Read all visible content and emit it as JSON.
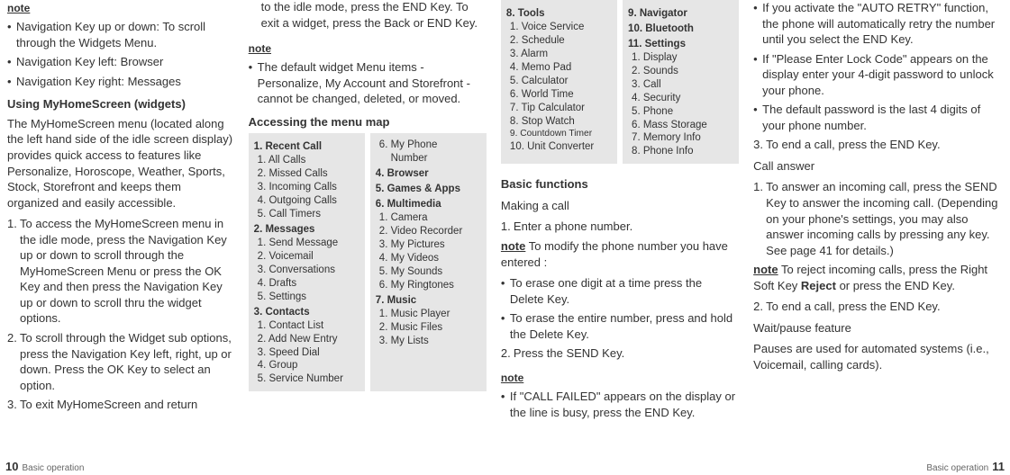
{
  "c1": {
    "noteLabel": "note",
    "b1": "Navigation Key up or down: To scroll through the Widgets Menu.",
    "b2": "Navigation Key left: Browser",
    "b3": "Navigation Key right: Messages",
    "h1": "Using MyHomeScreen (widgets)",
    "p1": "The MyHomeScreen menu (located along the left hand side of the idle screen display) provides quick access to features like Personalize, Horoscope, Weather, Sports, Stock, Storefront and keeps them organized and easily accessible.",
    "n1": "To access the MyHomeScreen menu in the idle mode, press the Navigation Key up or down to scroll through the MyHomeScreen Menu or press the OK Key and then press the Navigation Key up or down to scroll thru the widget options.",
    "n2": "To scroll through the Widget sub options, press the Navigation Key left, right, up or down. Press the OK Key to select an option.",
    "n3": "To exit MyHomeScreen and return",
    "footer": "Basic operation",
    "page": "10"
  },
  "c2": {
    "p0": "to the idle mode, press the END Key. To exit a widget, press the Back or END Key.",
    "noteLabel": "note",
    "b1": "The default widget Menu items - Personalize, My Account and Storefront - cannot be changed, deleted, or moved.",
    "h1": "Accessing the menu map"
  },
  "menuA": {
    "s1t": "1. Recent Call",
    "s1": [
      "1.  All Calls",
      "2. Missed Calls",
      "3. Incoming Calls",
      "4. Outgoing Calls",
      "5. Call Timers"
    ],
    "s2t": "2. Messages",
    "s2": [
      "1.  Send Message",
      "2. Voicemail",
      "3. Conversations",
      "4. Drafts",
      "5. Settings"
    ],
    "s3t": "3. Contacts",
    "s3": [
      "1.  Contact List",
      "2. Add New Entry",
      "3. Speed Dial",
      "4. Group",
      "5. Service Number"
    ]
  },
  "menuB": {
    "i1": "6. My Phone",
    "i1b": "    Number",
    "s4t": "4. Browser",
    "s5t": "5. Games & Apps",
    "s6t": "6. Multimedia",
    "s6": [
      "1.  Camera",
      "2. Video Recorder",
      "3. My Pictures",
      "4. My Videos",
      "5. My Sounds",
      "6. My Ringtones"
    ],
    "s7t": "7. Music",
    "s7": [
      "1.  Music Player",
      "2. Music Files",
      "3. My Lists"
    ]
  },
  "menuC": {
    "s8t": "8. Tools",
    "s8": [
      "1.  Voice Service",
      "2. Schedule",
      "3. Alarm",
      "4. Memo Pad",
      "5. Calculator",
      "6. World Time",
      "7.  Tip Calculator",
      "8. Stop Watch",
      "9. Countdown Timer",
      "10. Unit Converter"
    ]
  },
  "menuD": {
    "s9t": "9. Navigator",
    "s10t": "10. Bluetooth",
    "s11t": "11. Settings",
    "s11": [
      "1.  Display",
      "2. Sounds",
      "3. Call",
      "4. Security",
      "5. Phone",
      "6. Mass Storage",
      "7.  Memory Info",
      "8. Phone Info"
    ]
  },
  "c5": {
    "h1": "Basic functions",
    "h2": "Making a call",
    "n1": "Enter a phone number.",
    "noteWord": "note",
    "noteText": " To modify the phone number you have entered :",
    "b1": "To erase one digit at a time press the Delete Key.",
    "b2": "To erase the entire number, press and hold the Delete Key.",
    "n2": "Press the SEND Key.",
    "noteLabel2": "note",
    "b3": "If \"CALL FAILED\" appears on the display or the line is busy, press the END Key."
  },
  "c6": {
    "b1": "If you activate the \"AUTO RETRY\" function, the phone will automatically retry the number until you select the END Key.",
    "b2": "If \"Please Enter Lock Code\" appears on the display enter your 4-digit password to unlock your phone.",
    "b3": "The default password is the last 4 digits of your phone number.",
    "n3": "To end a call, press the END Key.",
    "h1": "Call answer",
    "n1": "To answer an incoming call, press the SEND Key to answer the incoming call. (Depending on your phone's settings, you may also answer incoming calls by pressing any key. See page 41 for details.)",
    "noteWord": "note",
    "noteTextA": " To reject incoming calls, press the Right Soft Key ",
    "reject": "Reject",
    "noteTextB": " or press the END Key.",
    "n2": "To end a call, press the END Key.",
    "h2": "Wait/pause feature",
    "p1": "Pauses are used for automated systems (i.e., Voicemail, calling cards).",
    "footer": "Basic operation",
    "page": "11"
  }
}
